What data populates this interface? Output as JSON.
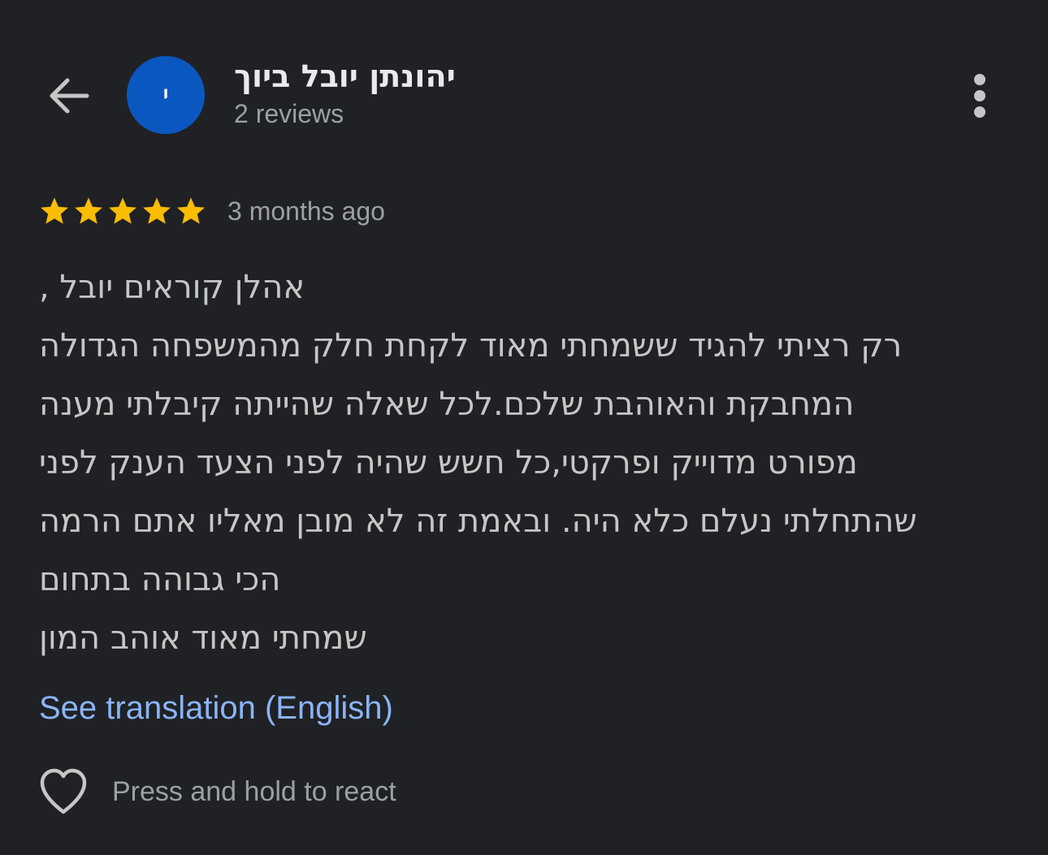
{
  "header": {
    "back_icon": "arrow-back-icon",
    "avatar_letter": "י",
    "avatar_color": "#0b57c0",
    "reviewer_name": "יהונתן יובל ביוך",
    "reviews_count": "2 reviews",
    "more_icon": "more-vert-icon"
  },
  "review": {
    "rating": 5,
    "max_rating": 5,
    "star_color": "#fbbc04",
    "date": "3 months ago",
    "lines": [
      "אהלן קוראים יובל ,",
      "רק רציתי להגיד ששמחתי מאוד לקחת חלק מהמשפחה הגדולה",
      "המחבקת והאוהבת שלכם.לכל שאלה שהייתה קיבלתי מענה",
      "מפורט מדוייק ופרקטי,כל חשש שהיה לפני הצעד הענק לפני",
      "שהתחלתי נעלם כלא היה. ובאמת זה לא מובן מאליו אתם הרמה",
      "הכי גבוהה בתחום",
      "שמחתי מאוד אוהב המון"
    ],
    "translate_label": "See translation (English)",
    "translate_color": "#8ab4f8"
  },
  "reactions": {
    "heart_icon": "heart-outline-icon",
    "label": "Press and hold to react"
  }
}
